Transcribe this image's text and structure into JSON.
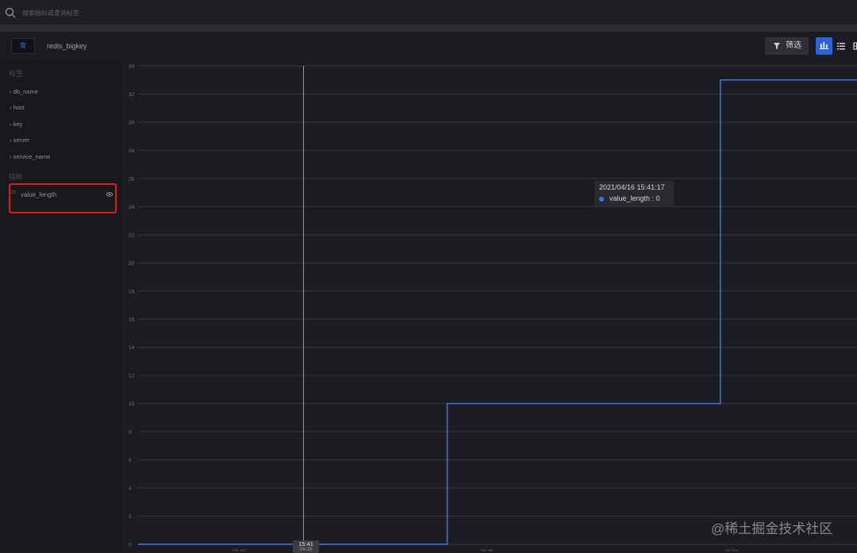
{
  "search": {
    "placeholder": "搜索指标或查询标签"
  },
  "header": {
    "badge": "度",
    "title": "redis_bigkey",
    "filter_label": "筛选"
  },
  "sidebar": {
    "tags_heading": "标签",
    "tags": [
      "db_name",
      "host",
      "key",
      "server",
      "service_name"
    ],
    "metrics_heading": "指标",
    "metric": {
      "icon_text": "23",
      "label": "value_length"
    }
  },
  "tooltip": {
    "time": "2021/04/16 15:41:17",
    "series_value": "value_length : 0"
  },
  "cursor": {
    "time": "15:41",
    "sub": "04-16"
  },
  "watermark": "@稀土掘金技术社区",
  "colors": {
    "accent": "#2c63d8",
    "line": "#3b73ea",
    "highlight_border": "#e3181f"
  },
  "chart_data": {
    "type": "line",
    "step": true,
    "series": [
      {
        "name": "value_length",
        "points": [
          [
            0,
            0
          ],
          [
            0.43,
            0
          ],
          [
            0.43,
            10
          ],
          [
            0.81,
            10
          ],
          [
            0.81,
            33
          ],
          [
            1.0,
            33
          ]
        ]
      }
    ],
    "ylim": [
      0,
      34
    ],
    "yticks": [
      0,
      2,
      4,
      6,
      8,
      10,
      12,
      14,
      16,
      18,
      20,
      22,
      24,
      26,
      28,
      30,
      32,
      34
    ],
    "x_tick_labels": [
      "15:40",
      "15:45",
      "15:50"
    ],
    "cursor_x": 0.23,
    "grid": true
  }
}
